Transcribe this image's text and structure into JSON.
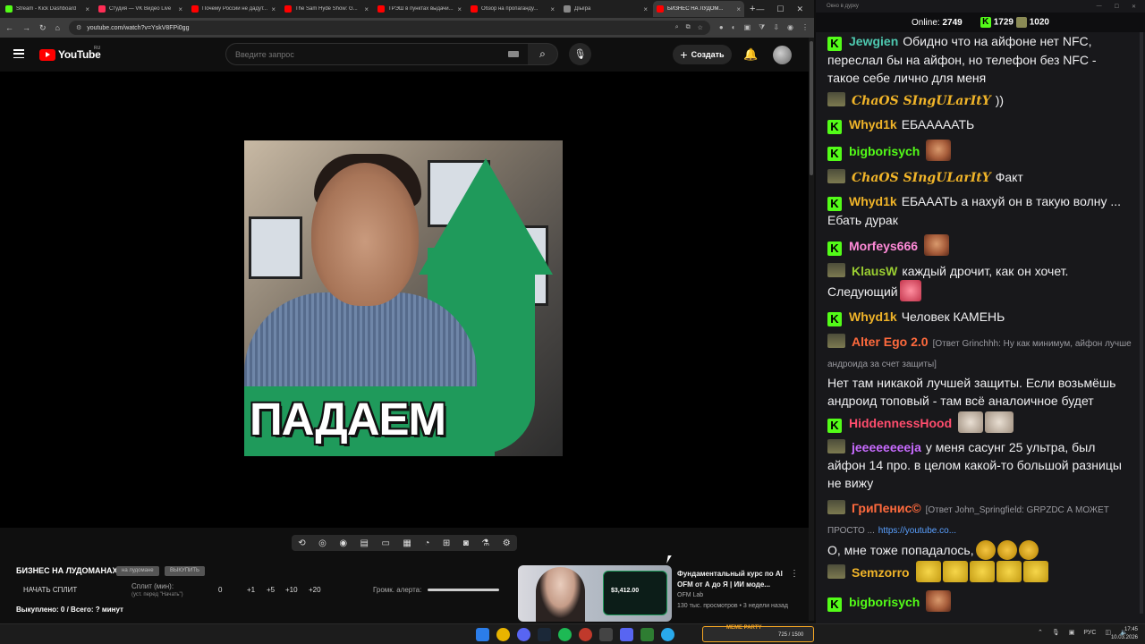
{
  "browser": {
    "tabs": [
      {
        "title": "Stream - Kick Dashboard",
        "color": "#53fc18"
      },
      {
        "title": "Студия — VK Видео Live",
        "color": "#ff2d55"
      },
      {
        "title": "Почему России не дадут...",
        "color": "#ff0000"
      },
      {
        "title": "The Sam Hyde Show: G...",
        "color": "#ff0000"
      },
      {
        "title": "ТРЭШ в пунктах выдачи...",
        "color": "#ff0000"
      },
      {
        "title": "Обзор на пропаганду...",
        "color": "#ff0000"
      },
      {
        "title": "Дїыїра",
        "color": "#888888"
      },
      {
        "title": "БИЗНЕС НА ЛУДОМ...",
        "color": "#ff0000"
      }
    ],
    "url": "youtube.com/watch?v=YskV8FPi0gg"
  },
  "youtube": {
    "logo_text": "YouTube",
    "region": "RU",
    "search_placeholder": "Введите запрос",
    "create_label": "Создать",
    "video_caption": "ПАДАЕМ"
  },
  "panel": {
    "title": "БИЗНЕС НА ЛУДОМАНАХ",
    "badge1": "на лудомане",
    "badge2": "ВЫКУПИТЬ",
    "start_split": "НАЧАТЬ СПЛИТ",
    "split_label": "Сплит (мин):",
    "split_hint": "(уст. перед \"Начать\")",
    "split_values": [
      "0",
      "+1",
      "+5",
      "+10",
      "+20"
    ],
    "alert_volume": "Громк. алерта:",
    "bought_line": "Выкуплено: 0 / Всего: ? минут"
  },
  "recommended": {
    "title": "Фундаментальный курс по AI OFM от А до Я | ИИ моде...",
    "channel": "OFM Lab",
    "meta": "130 тыс. просмотров • 3 недели назад",
    "thumb_amount": "$3,412.00"
  },
  "chat": {
    "window_title": "Окно в дурку",
    "online_label": "Online:",
    "online_value": "2749",
    "kick_count": "1729",
    "other_count": "1020",
    "messages": [
      {
        "user": "Jewgien",
        "color": "#4ec9b0",
        "text": "Обидно что на айфоне нет NFC, переслал бы на айфон, но телефон без NFC - такое себе лично для меня"
      },
      {
        "user": "ChaOS SIngULarItY",
        "color": "#f0b429",
        "text": "))"
      },
      {
        "user": "Whyd1k",
        "color": "#f0b429",
        "text": "ЕБАААААТЬ"
      },
      {
        "user": "bigborisych",
        "color": "#53fc18",
        "text": ""
      },
      {
        "user": "ChaOS SIngULarItY",
        "color": "#f0b429",
        "text": "Факт"
      },
      {
        "user": "Whyd1k",
        "color": "#f0b429",
        "text": "ЕБАААТЬ а нахуй он в такую волну ... Ебать дурак"
      },
      {
        "user": "Morfeys666",
        "color": "#ff8ad8",
        "text": ""
      },
      {
        "user": "KlausW",
        "color": "#9acd32",
        "text": "каждый дрочит, как он хочет. Следующий"
      },
      {
        "user": "Whyd1k",
        "color": "#f0b429",
        "text": "Человек КАМЕНЬ"
      },
      {
        "user": "Alter Ego 2.0",
        "color": "#ff6a3d",
        "reply": "[Ответ Grinchhh: Ну как минимум, айфон лучше андроида за счет защиты]",
        "text": "Нет там никакой лучшей защиты. Если возьмёшь андроид топовый - там всё аналоичное будет"
      },
      {
        "user": "HiddennessHood",
        "color": "#ff4d6d",
        "text": ""
      },
      {
        "user": "jeeeeeeeeja",
        "color": "#c86bff",
        "text": "у меня сасунг 25 ультра, был айфон 14 про. в целом какой-то большой разницы не вижу"
      },
      {
        "user": "ГриПенис©",
        "color": "#ff6a3d",
        "reply": "[Ответ John_Springfield: GRPZDC А МОЖЕТ ПРОСТО ...",
        "link": "https://youtube.co...",
        "text": "О, мне тоже попадалось,"
      },
      {
        "user": "Semzorro",
        "color": "#f0b429",
        "text": ""
      },
      {
        "user": "bigborisych",
        "color": "#53fc18",
        "text": ""
      }
    ]
  },
  "taskbar": {
    "meme_label": "MEME PARTY",
    "meme_count": "725 / 1500",
    "lang": "РУС",
    "time": "17:45",
    "date": "10.03.2026"
  }
}
